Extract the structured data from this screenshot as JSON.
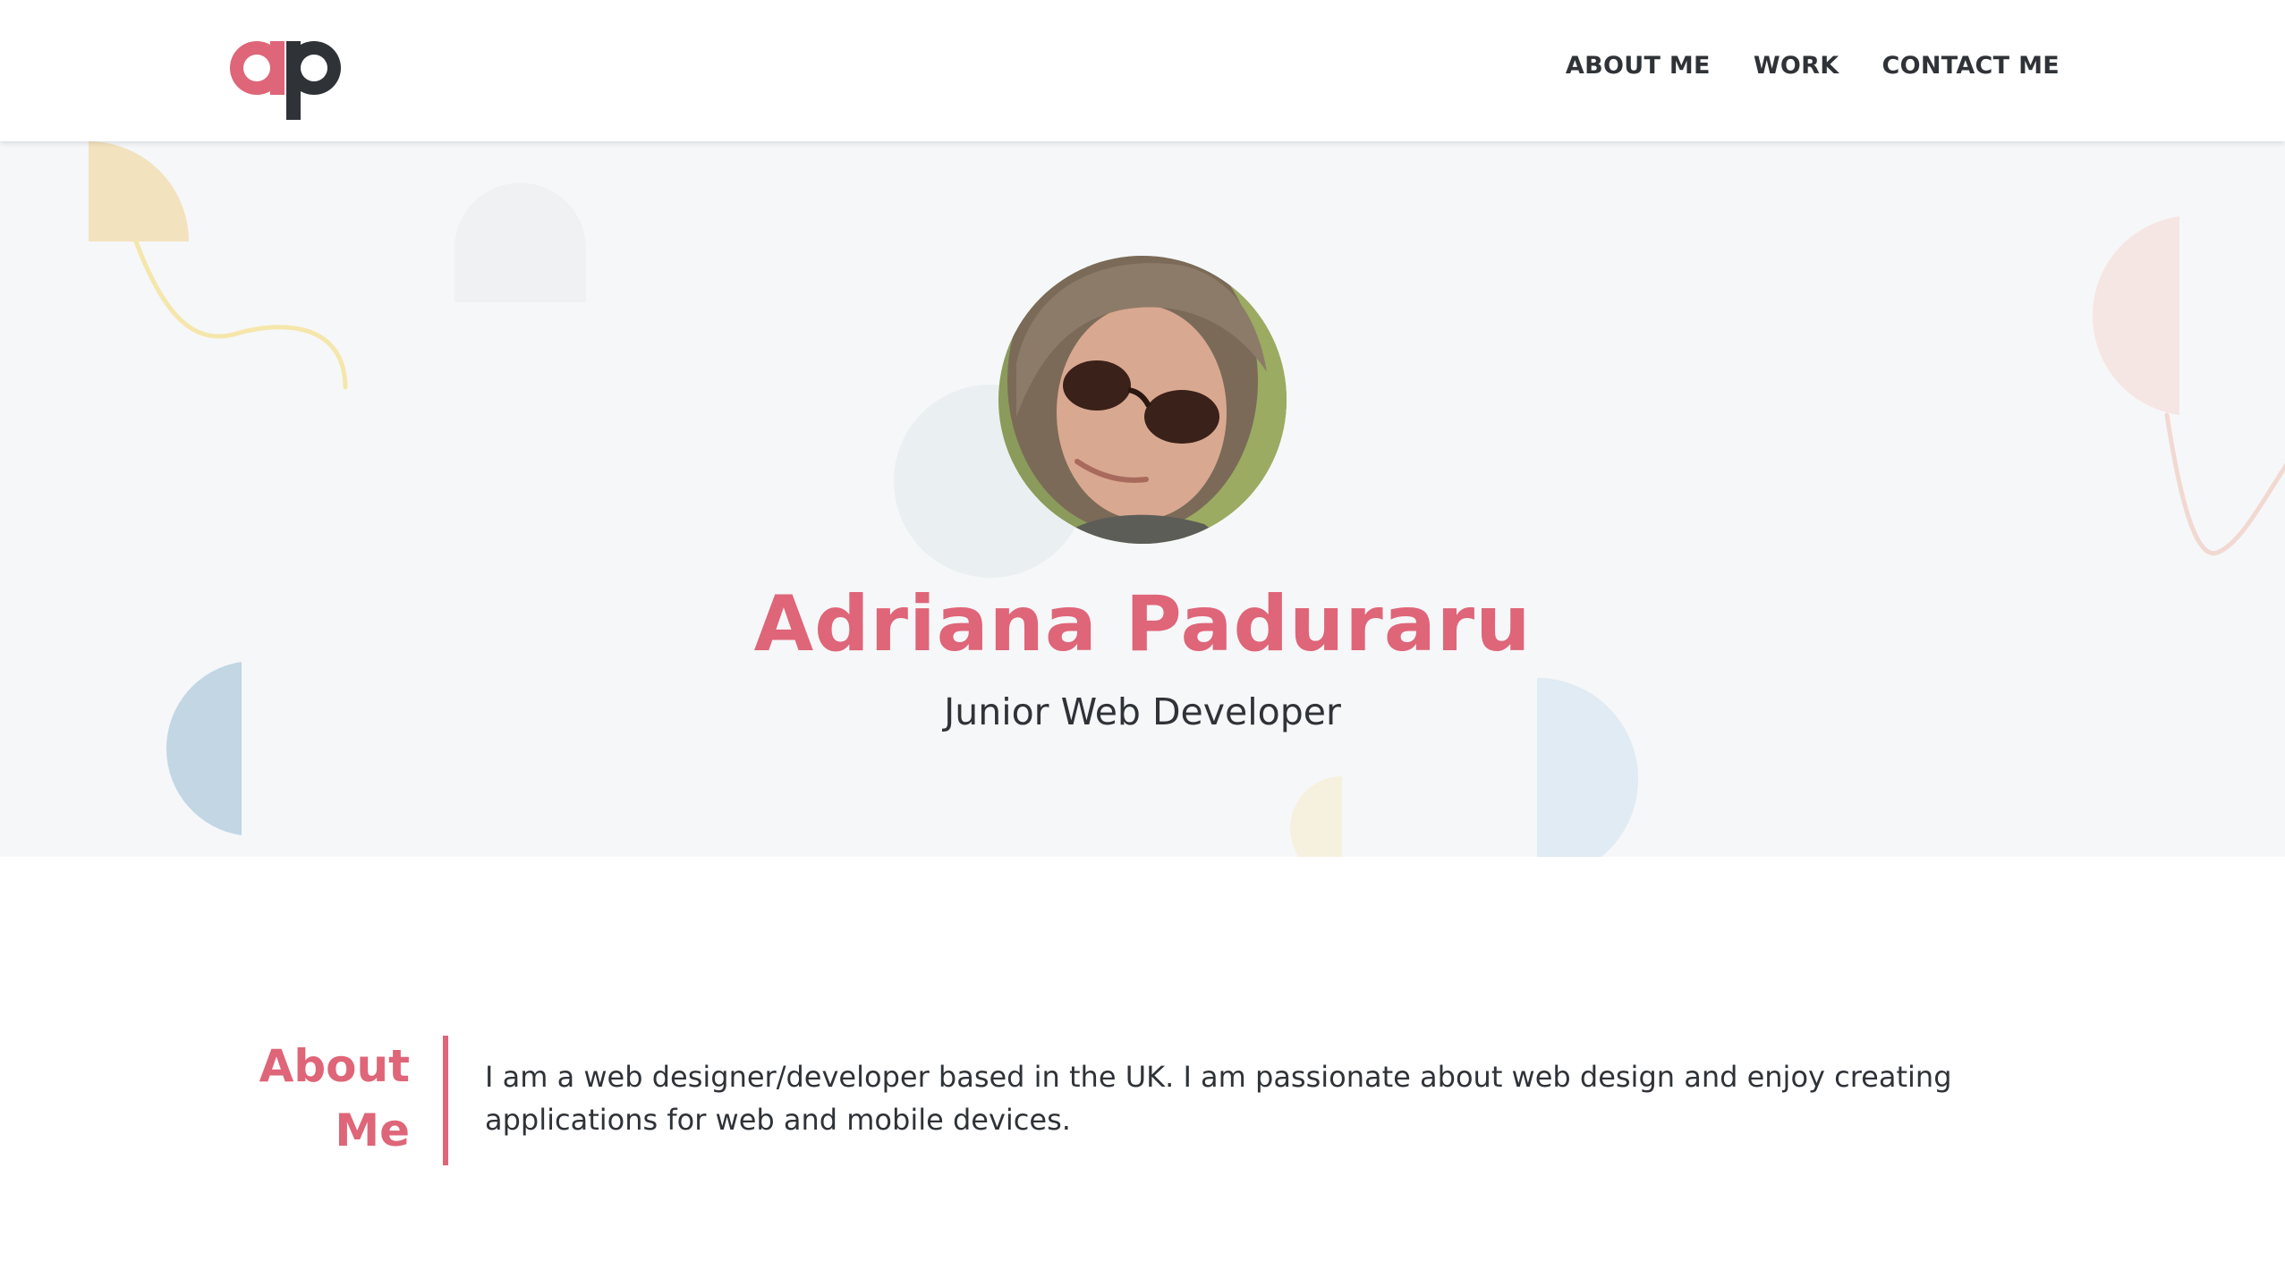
{
  "header": {
    "logo_letters": "ap",
    "nav": [
      {
        "label": "ABOUT ME"
      },
      {
        "label": "WORK"
      },
      {
        "label": "CONTACT ME"
      }
    ]
  },
  "hero": {
    "name": "Adriana Paduraru",
    "role": "Junior Web Developer"
  },
  "about": {
    "heading_line1": "About",
    "heading_line2": "Me",
    "text": "I am a web designer/developer based in the UK. I am passionate about web design and enjoy creating applications for web and mobile devices."
  },
  "colors": {
    "accent": "#df6578",
    "text": "#2f3338",
    "hero_bg": "#f6f7f9"
  }
}
